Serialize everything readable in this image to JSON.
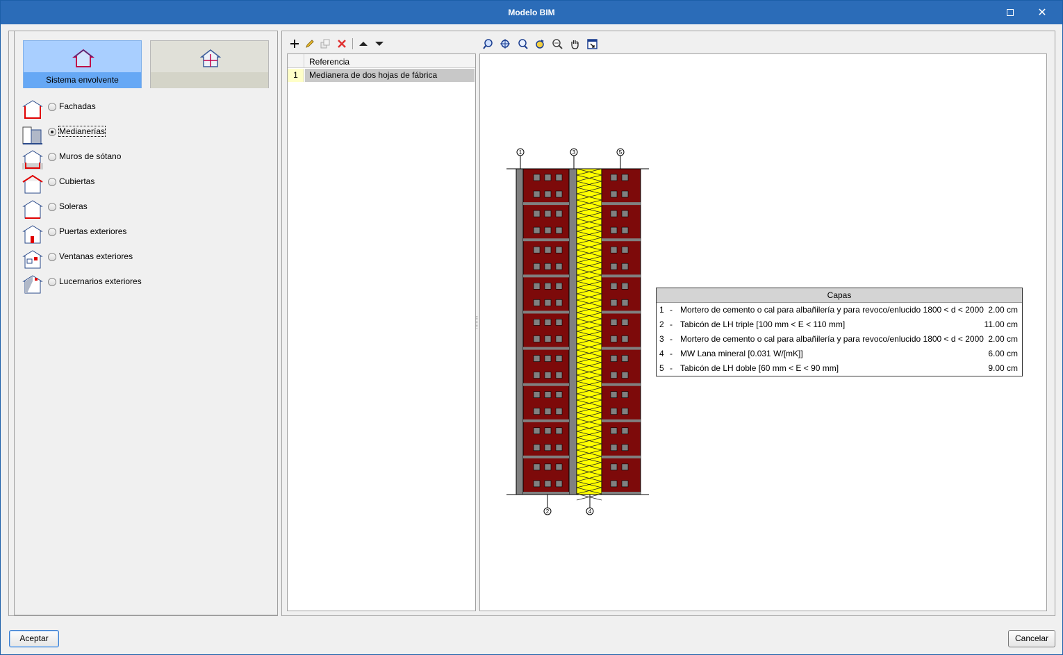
{
  "window": {
    "title": "Modelo BIM"
  },
  "left_panel": {
    "main_button_label": "Sistema envolvente",
    "options": [
      {
        "label": "Fachadas",
        "checked": false
      },
      {
        "label": "Medianerías",
        "checked": true
      },
      {
        "label": "Muros de sótano",
        "checked": false
      },
      {
        "label": "Cubiertas",
        "checked": false
      },
      {
        "label": "Soleras",
        "checked": false
      },
      {
        "label": "Puertas exteriores",
        "checked": false
      },
      {
        "label": "Ventanas exteriores",
        "checked": false
      },
      {
        "label": "Lucernarios exteriores",
        "checked": false
      }
    ]
  },
  "list": {
    "header": "Referencia",
    "rows": [
      {
        "num": "1",
        "value": "Medianera de dos hojas de fábrica"
      }
    ]
  },
  "drawing": {
    "top_markers": [
      "1",
      "3",
      "5"
    ],
    "bottom_markers": [
      "2",
      "4"
    ],
    "colors": {
      "brick": "#7d0a0a",
      "mortar": "#808080",
      "insulation": "#ffff00"
    }
  },
  "capas": {
    "title": "Capas",
    "layers": [
      {
        "num": "1",
        "dash": "-",
        "desc": "Mortero de cemento o cal para albañilería y para revoco/enlucido 1800 < d < 2000",
        "thickness": "2.00 cm"
      },
      {
        "num": "2",
        "dash": "-",
        "desc": "Tabicón de LH triple [100 mm < E < 110 mm]",
        "thickness": "11.00 cm"
      },
      {
        "num": "3",
        "dash": "-",
        "desc": "Mortero de cemento o cal para albañilería y para revoco/enlucido 1800 < d < 2000",
        "thickness": "2.00 cm"
      },
      {
        "num": "4",
        "dash": "-",
        "desc": "MW Lana mineral [0.031 W/[mK]]",
        "thickness": "6.00 cm"
      },
      {
        "num": "5",
        "dash": "-",
        "desc": "Tabicón de LH doble  [60 mm < E < 90 mm]",
        "thickness": "9.00 cm"
      }
    ]
  },
  "footer": {
    "accept": "Aceptar",
    "cancel": "Cancelar"
  }
}
